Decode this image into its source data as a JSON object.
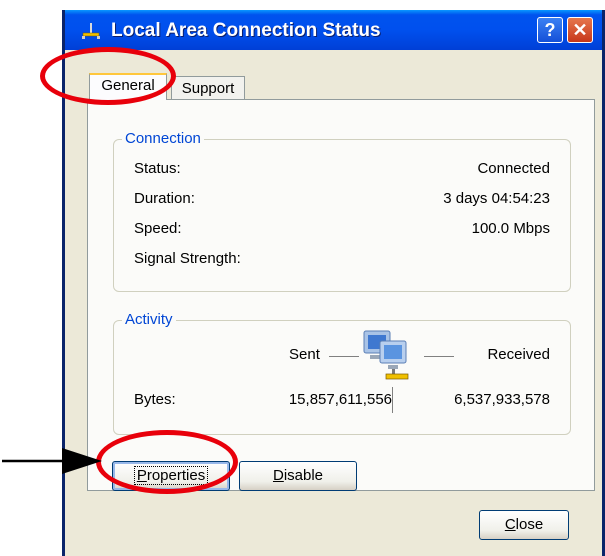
{
  "window": {
    "title": "Local Area Connection Status",
    "help_glyph": "?",
    "close_glyph": "✕"
  },
  "tabs": [
    {
      "label": "General",
      "selected": true
    },
    {
      "label": "Support",
      "selected": false
    }
  ],
  "connection": {
    "legend": "Connection",
    "rows": [
      {
        "label": "Status:",
        "value": "Connected"
      },
      {
        "label": "Duration:",
        "value": "3 days 04:54:23"
      },
      {
        "label": "Speed:",
        "value": "100.0 Mbps"
      },
      {
        "label": "Signal Strength:",
        "value": ""
      }
    ]
  },
  "activity": {
    "legend": "Activity",
    "sent_label": "Sent",
    "received_label": "Received",
    "bytes_label": "Bytes:",
    "bytes_sent": "15,857,611,556",
    "bytes_received": "6,537,933,578"
  },
  "buttons": {
    "properties": {
      "before": "",
      "accel": "P",
      "after": "roperties"
    },
    "disable": {
      "before": "",
      "accel": "D",
      "after": "isable"
    },
    "close": {
      "before": "",
      "accel": "C",
      "after": "lose"
    }
  },
  "colors": {
    "title_bar": "#0050ee",
    "annotation": "#e8000b",
    "group_legend": "#0046d5",
    "dialog_bg": "#ece9d8"
  }
}
